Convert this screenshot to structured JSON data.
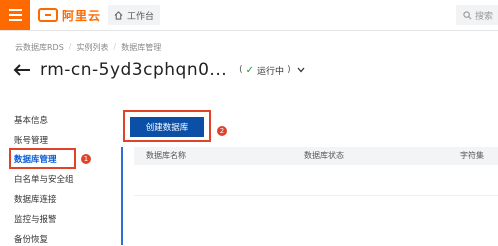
{
  "topbar": {
    "logo_text": "阿里云",
    "home_label": "工作台",
    "search_placeholder": "搜索"
  },
  "breadcrumb": [
    "云数据库RDS",
    "实例列表",
    "数据库管理"
  ],
  "instance": {
    "title": "rm-cn-5yd3cphqn0...",
    "status": "运行中"
  },
  "sidebar": {
    "items": [
      {
        "label": "基本信息"
      },
      {
        "label": "账号管理"
      },
      {
        "label": "数据库管理"
      },
      {
        "label": "白名单与安全组"
      },
      {
        "label": "数据库连接"
      },
      {
        "label": "监控与报警"
      },
      {
        "label": "备份恢复"
      }
    ]
  },
  "annotations": {
    "step1": "1",
    "step2": "2"
  },
  "main": {
    "create_button": "创建数据库",
    "columns": [
      "数据库名称",
      "数据库状态",
      "字符集"
    ]
  },
  "colors": {
    "brand": "#ff6a00",
    "primary_button": "#0b4fa6",
    "highlight": "#e0432a",
    "status_ok": "#1a9e3a"
  }
}
